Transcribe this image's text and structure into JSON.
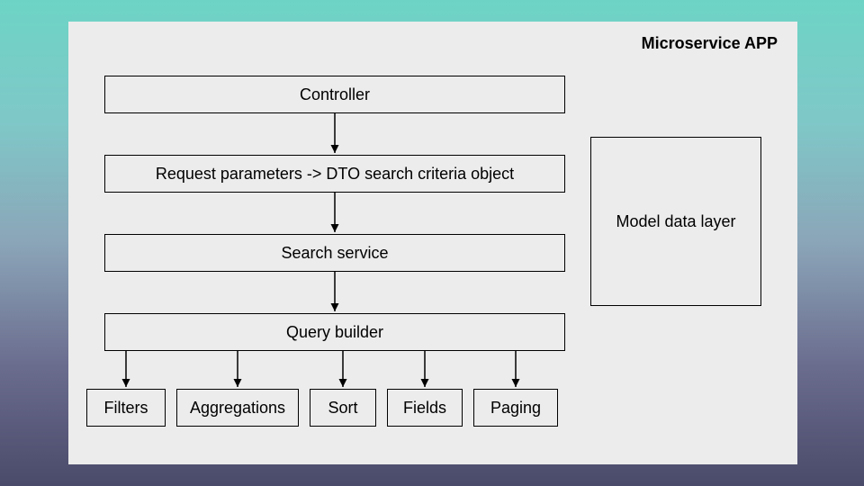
{
  "title": "Microservice APP",
  "flow": {
    "controller": "Controller",
    "dto": "Request parameters -> DTO search criteria object",
    "search_service": "Search service",
    "query_builder": "Query builder"
  },
  "query_parts": {
    "filters": "Filters",
    "aggregations": "Aggregations",
    "sort": "Sort",
    "fields": "Fields",
    "paging": "Paging"
  },
  "model_layer": "Model data layer"
}
